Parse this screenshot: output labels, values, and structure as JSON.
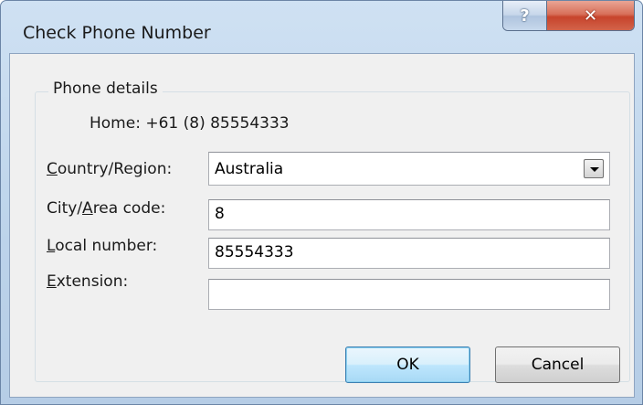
{
  "window": {
    "title": "Check Phone Number",
    "help_glyph": "?",
    "close_glyph": "✕"
  },
  "group": {
    "label": "Phone details",
    "home_line": "Home: +61 (8) 85554333"
  },
  "fields": {
    "country": {
      "label_mnemonic": "C",
      "label_rest": "ountry/Region:",
      "value": "Australia"
    },
    "city": {
      "label_pre": "City/",
      "label_mnemonic": "A",
      "label_rest": "rea code:",
      "value": "8"
    },
    "local": {
      "label_mnemonic": "L",
      "label_rest": "ocal number:",
      "value": "85554333"
    },
    "extension": {
      "label_mnemonic": "E",
      "label_rest": "xtension:",
      "value": ""
    }
  },
  "buttons": {
    "ok": "OK",
    "cancel": "Cancel"
  }
}
